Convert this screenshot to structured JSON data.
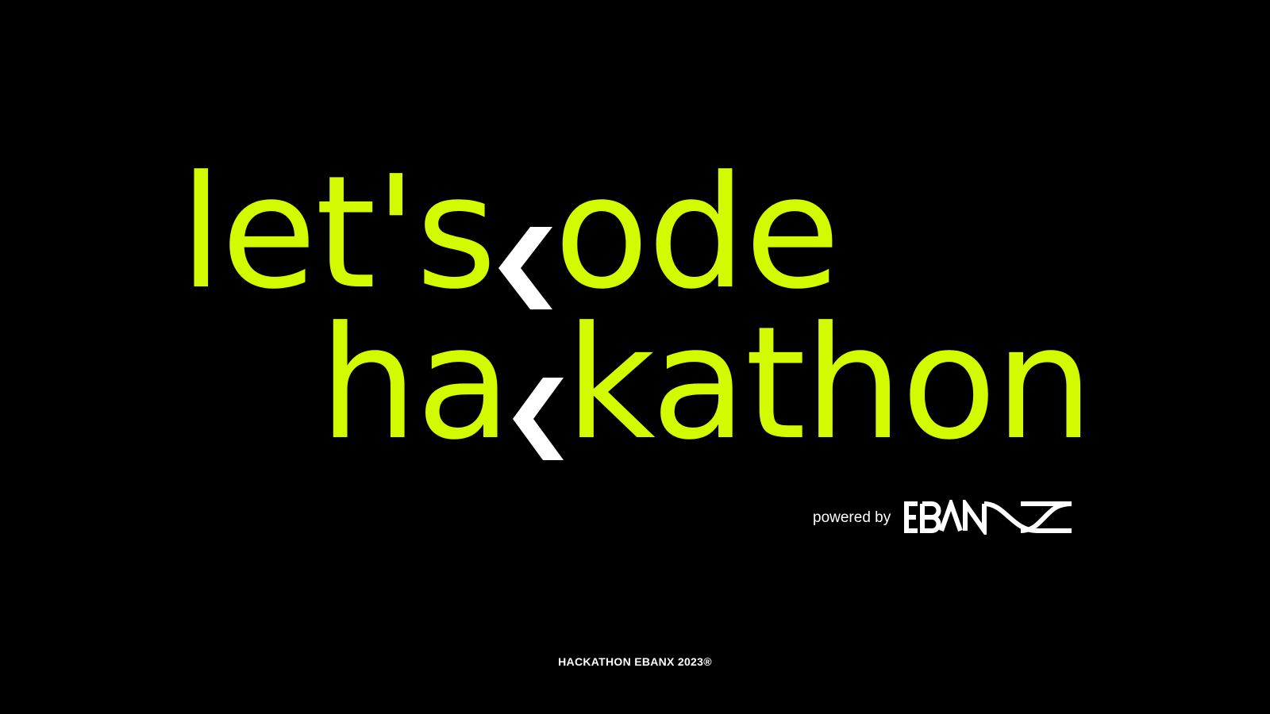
{
  "title": {
    "line1": {
      "before": "let's",
      "after": "ode"
    },
    "line2": {
      "before": "ha",
      "after": "kathon"
    }
  },
  "branding": {
    "powered_by": "powered by",
    "logo_text": "EBANX"
  },
  "footer": "HACKATHON EBANX 2023®",
  "colors": {
    "background": "#000000",
    "accent": "#D4FA00",
    "chevron": "#FFFFFF",
    "text": "#FFFFFF"
  },
  "icons": [
    "chevron-left-icon",
    "ebanx-logo"
  ]
}
